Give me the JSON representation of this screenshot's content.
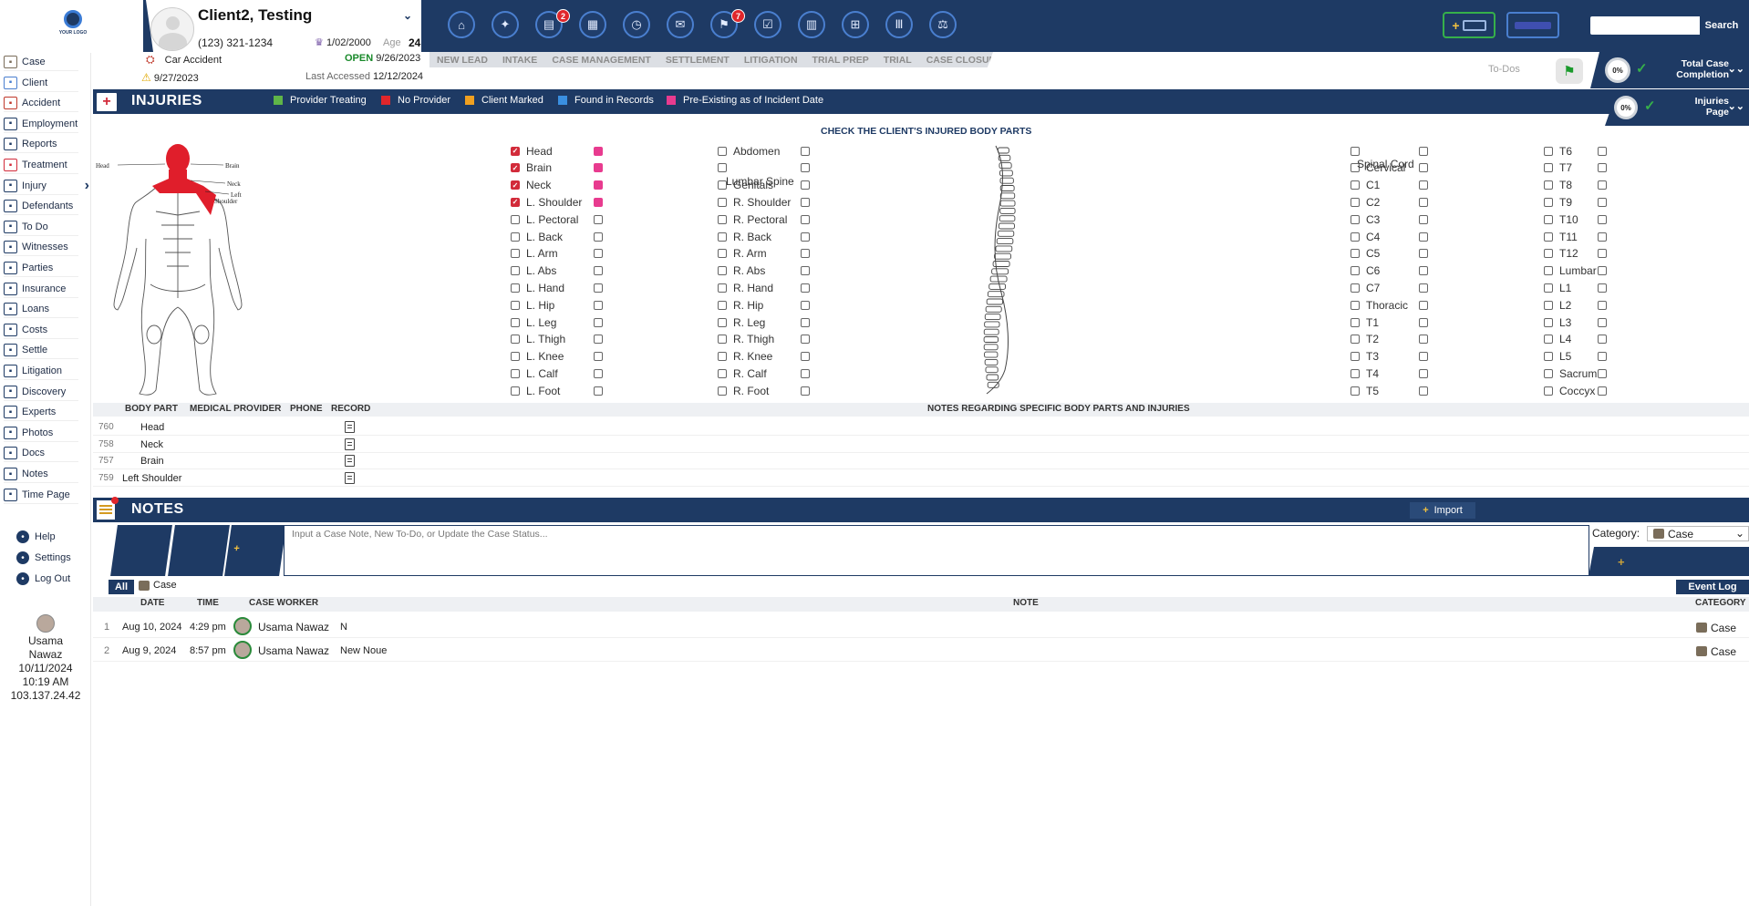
{
  "header": {
    "logo_text": "YOUR LOGO",
    "client_name": "Client2, Testing",
    "phone": "(123) 321-1234",
    "dob": "1/02/2000",
    "age_label": "Age",
    "age": "24",
    "case_type": "Car Accident",
    "open_label": "OPEN",
    "open_date": "9/26/2023",
    "incident_date": "9/27/2023",
    "last_accessed_label": "Last Accessed",
    "last_accessed_date": "12/12/2024",
    "search_placeholder": "",
    "search_label": "Search",
    "nav_icons": [
      {
        "name": "home-icon",
        "glyph": "⌂"
      },
      {
        "name": "compass-icon",
        "glyph": "✦"
      },
      {
        "name": "document-icon",
        "glyph": "▤",
        "badge": "2"
      },
      {
        "name": "calendar-icon",
        "glyph": "▦"
      },
      {
        "name": "clock-icon",
        "glyph": "◷"
      },
      {
        "name": "chat-icon",
        "glyph": "✉"
      },
      {
        "name": "flag-icon",
        "glyph": "⚑",
        "badge": "7"
      },
      {
        "name": "checklist-icon",
        "glyph": "☑"
      },
      {
        "name": "book-icon",
        "glyph": "▥"
      },
      {
        "name": "grid-icon",
        "glyph": "⊞"
      },
      {
        "name": "library-icon",
        "glyph": "Ⅲ"
      },
      {
        "name": "scales-icon",
        "glyph": "⚖"
      }
    ]
  },
  "stages": [
    "NEW LEAD",
    "INTAKE",
    "CASE MANAGEMENT",
    "SETTLEMENT",
    "LITIGATION",
    "TRIAL PREP",
    "TRIAL",
    "CASE CLOSURE"
  ],
  "todos_label": "To-Dos",
  "completion": {
    "percent": "0%",
    "label_line1": "Total Case",
    "label_line2": "Completion"
  },
  "injuries_page": {
    "percent": "0%",
    "label_line1": "Injuries",
    "label_line2": "Page"
  },
  "sidebar": {
    "items": [
      {
        "label": "Case",
        "icon": "case-icon",
        "color": "#7a6d5a"
      },
      {
        "label": "Client",
        "icon": "client-icon",
        "color": "#4a7fcf"
      },
      {
        "label": "Accident",
        "icon": "car-icon",
        "color": "#c0392b"
      },
      {
        "label": "Employment",
        "icon": "employment-icon",
        "color": "#1e3a64"
      },
      {
        "label": "Reports",
        "icon": "reports-icon",
        "color": "#1e3a64"
      },
      {
        "label": "Treatment",
        "icon": "treatment-icon",
        "color": "#d22b3a"
      },
      {
        "label": "Injury",
        "icon": "injury-icon",
        "color": "#1e3a64"
      },
      {
        "label": "Defendants",
        "icon": "defendants-icon",
        "color": "#1e3a64"
      },
      {
        "label": "To Do",
        "icon": "todo-icon",
        "color": "#1e3a64"
      },
      {
        "label": "Witnesses",
        "icon": "witnesses-icon",
        "color": "#1e3a64"
      },
      {
        "label": "Parties",
        "icon": "parties-icon",
        "color": "#1e3a64"
      },
      {
        "label": "Insurance",
        "icon": "insurance-icon",
        "color": "#1e3a64"
      },
      {
        "label": "Loans",
        "icon": "loans-icon",
        "color": "#1e3a64"
      },
      {
        "label": "Costs",
        "icon": "costs-icon",
        "color": "#1e3a64"
      },
      {
        "label": "Settle",
        "icon": "settle-icon",
        "color": "#1e3a64"
      },
      {
        "label": "Litigation",
        "icon": "litigation-icon",
        "color": "#1e3a64"
      },
      {
        "label": "Discovery",
        "icon": "discovery-icon",
        "color": "#1e3a64"
      },
      {
        "label": "Experts",
        "icon": "experts-icon",
        "color": "#1e3a64"
      },
      {
        "label": "Photos",
        "icon": "photos-icon",
        "color": "#1e3a64"
      },
      {
        "label": "Docs",
        "icon": "docs-icon",
        "color": "#1e3a64"
      },
      {
        "label": "Notes",
        "icon": "notes-icon",
        "color": "#1e3a64"
      },
      {
        "label": "Time Page",
        "icon": "time-icon",
        "color": "#1e3a64"
      }
    ],
    "utilities": [
      {
        "label": "Help",
        "icon": "help-icon"
      },
      {
        "label": "Settings",
        "icon": "settings-icon"
      },
      {
        "label": "Log Out",
        "icon": "logout-icon"
      }
    ],
    "user": {
      "first": "Usama",
      "last": "Nawaz",
      "date": "10/11/2024",
      "time": "10:19 AM",
      "ip": "103.137.24.42"
    }
  },
  "injuries": {
    "title": "INJURIES",
    "legend": [
      {
        "label": "Provider Treating",
        "color": "#5fb548"
      },
      {
        "label": "No Provider",
        "color": "#e0262b"
      },
      {
        "label": "Client Marked",
        "color": "#f0a020"
      },
      {
        "label": "Found in Records",
        "color": "#3a8fe0"
      },
      {
        "label": "Pre-Existing as of Incident Date",
        "color": "#e83b8f"
      }
    ],
    "check_title": "CHECK THE CLIENT'S INJURED BODY PARTS",
    "figure_labels": {
      "head": "Head",
      "brain": "Brain",
      "neck": "Neck",
      "left_shoulder_1": "Left",
      "left_shoulder_2": "Shoulder"
    },
    "col1": [
      {
        "label": "Head",
        "checked": true,
        "pre": true
      },
      {
        "label": "Brain",
        "checked": true,
        "pre": true
      },
      {
        "label": "Neck",
        "checked": true,
        "pre": true
      },
      {
        "label": "L. Shoulder",
        "checked": true,
        "pre": true
      },
      {
        "label": "L. Pectoral"
      },
      {
        "label": "L. Back"
      },
      {
        "label": "L. Arm"
      },
      {
        "label": "L. Abs"
      },
      {
        "label": "L. Hand"
      },
      {
        "label": "L. Hip"
      },
      {
        "label": "L. Leg"
      },
      {
        "label": "L. Thigh"
      },
      {
        "label": "L. Knee"
      },
      {
        "label": "L. Calf"
      },
      {
        "label": "L. Foot"
      }
    ],
    "col2": [
      {
        "label": "Abdomen"
      },
      {
        "label": ""
      },
      {
        "label": "Genitals"
      },
      {
        "label": "R. Shoulder"
      },
      {
        "label": "R. Pectoral"
      },
      {
        "label": "R. Back"
      },
      {
        "label": "R. Arm"
      },
      {
        "label": "R. Abs"
      },
      {
        "label": "R. Hand"
      },
      {
        "label": "R. Hip"
      },
      {
        "label": "R. Leg"
      },
      {
        "label": "R. Thigh"
      },
      {
        "label": "R. Knee"
      },
      {
        "label": "R. Calf"
      },
      {
        "label": "R. Foot"
      }
    ],
    "col2_overlay": "Lumbar Spine",
    "col3": [
      {
        "label": ""
      },
      {
        "label": "Cervical"
      },
      {
        "label": "C1"
      },
      {
        "label": "C2"
      },
      {
        "label": "C3"
      },
      {
        "label": "C4"
      },
      {
        "label": "C5"
      },
      {
        "label": "C6"
      },
      {
        "label": "C7"
      },
      {
        "label": "Thoracic"
      },
      {
        "label": "T1"
      },
      {
        "label": "T2"
      },
      {
        "label": "T3"
      },
      {
        "label": "T4"
      },
      {
        "label": "T5"
      }
    ],
    "col3_overlay": "Spinal Cord",
    "col4": [
      {
        "label": "T6"
      },
      {
        "label": "T7"
      },
      {
        "label": "T8"
      },
      {
        "label": "T9"
      },
      {
        "label": "T10"
      },
      {
        "label": "T11"
      },
      {
        "label": "T12"
      },
      {
        "label": "Lumbar"
      },
      {
        "label": "L1"
      },
      {
        "label": "L2"
      },
      {
        "label": "L3"
      },
      {
        "label": "L4"
      },
      {
        "label": "L5"
      },
      {
        "label": "Sacrum"
      },
      {
        "label": "Coccyx"
      }
    ],
    "table_headers": {
      "body_part": "BODY PART",
      "provider": "MEDICAL PROVIDER",
      "phone": "PHONE",
      "record": "RECORD",
      "notes": "NOTES REGARDING SPECIFIC BODY PARTS AND INJURIES"
    },
    "rows": [
      {
        "id": "760",
        "part": "Head"
      },
      {
        "id": "758",
        "part": "Neck"
      },
      {
        "id": "757",
        "part": "Brain"
      },
      {
        "id": "759",
        "part": "Left Shoulder"
      }
    ]
  },
  "notes": {
    "title": "NOTES",
    "import_label": "Import",
    "input_placeholder": "Input a Case Note, New To-Do, or Update the Case Status...",
    "category_label": "Category:",
    "category_value": "Case",
    "filter_all": "All",
    "filter_case": "Case",
    "event_log": "Event Log",
    "headers": {
      "date": "DATE",
      "time": "TIME",
      "worker": "CASE WORKER",
      "note": "NOTE",
      "category": "CATEGORY"
    },
    "rows": [
      {
        "n": "1",
        "date": "Aug 10, 2024",
        "time": "4:29 pm",
        "worker": "Usama Nawaz",
        "note": "N",
        "category": "Case"
      },
      {
        "n": "2",
        "date": "Aug 9, 2024",
        "time": "8:57 pm",
        "worker": "Usama Nawaz",
        "note": "New Noue",
        "category": "Case"
      }
    ]
  }
}
